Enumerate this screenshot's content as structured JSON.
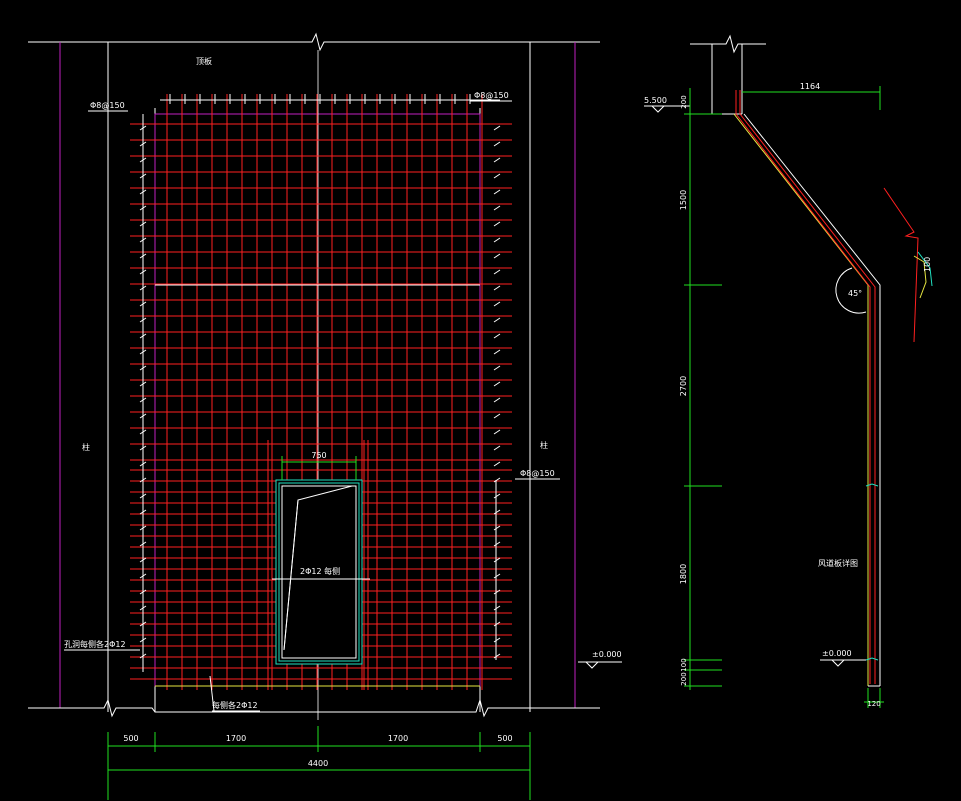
{
  "colors": {
    "background": "#000000",
    "outline": "#ffffff",
    "column": "#c020c0",
    "rebar": "#ff2020",
    "dimension": "#20e020",
    "slab": "#e6e640",
    "opening": "#20e0c0",
    "text": "#ffffff"
  },
  "elevation": {
    "top_label": "顶板",
    "left_column_label": "柱",
    "right_column_label": "柱",
    "rebar_top_left": "Φ8@150",
    "rebar_top_right": "Φ8@150",
    "rebar_right": "Φ8@150",
    "opening_dim": "750",
    "opening_bar": "2Φ12 每侧",
    "left_bottom_note": "孔洞每侧各2Φ12",
    "bottom_note": "每侧各2Φ12",
    "level_zero": "±0.000",
    "bottom_dims": [
      "500",
      "1700",
      "1700",
      "500"
    ],
    "total_dim": "4400"
  },
  "section": {
    "level_top": "5.500",
    "top_dim": "200",
    "horizontal_dim": "1164",
    "vertical_dims": [
      "1500",
      "2700",
      "1800",
      "100",
      "200"
    ],
    "bend_angle": "45°",
    "detail_dim": "100",
    "wind_label": "风道板详图",
    "level_zero": "±0.000",
    "thickness_dim": "120"
  }
}
